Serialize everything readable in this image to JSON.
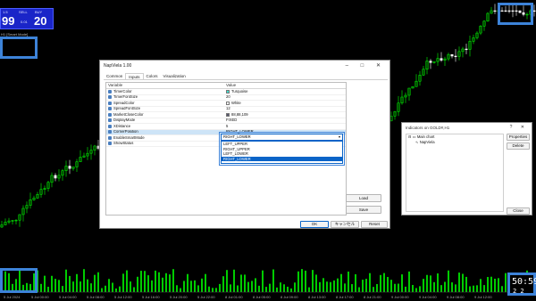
{
  "chart": {
    "symbol_bar": "GOLD#,H1: GOLD",
    "sub_label": "H1 [Smart Mode]",
    "bid_small": "1.5",
    "ask_small": "SELL",
    "buy_small": "BUY",
    "bid_big": "99",
    "ask_big": "20",
    "mid_label": "0.01",
    "spread_label": "2,670",
    "timer_main": "50:59",
    "timer_sub": "2 2",
    "x_labels": [
      "5 Jul 2024",
      "5 Jul 00:00",
      "5 Jul 04:00",
      "5 Jul 08:00",
      "5 Jul 12:00",
      "5 Jul 16:00",
      "5 Jul 20:00",
      "5 Jul 22:00",
      "8 Jul 01:00",
      "8 Jul 05:00",
      "8 Jul 09:00",
      "8 Jul 13:00",
      "8 Jul 17:00",
      "8 Jul 21:00",
      "9 Jul 00:00",
      "9 Jul 04:00",
      "9 Jul 08:00",
      "9 Jul 12:00"
    ]
  },
  "dialog": {
    "title": "NapViela 1.00",
    "window_buttons": "–  □  ✕",
    "tabs": [
      "Common",
      "Inputs",
      "Colors",
      "Visualization"
    ],
    "columns": {
      "variable": "Variable",
      "value": "Value"
    },
    "rows": [
      {
        "variable": "TimerColor",
        "value": "Turquoise",
        "swatch": "#40e0d0"
      },
      {
        "variable": "TimerFontSize",
        "value": "20"
      },
      {
        "variable": "SpreadColor",
        "value": "White",
        "swatch": "#ffffff"
      },
      {
        "variable": "SpreadFontSize",
        "value": "12"
      },
      {
        "variable": "MarketCloseColor",
        "value": "88,88,109",
        "swatch": "#58586d"
      },
      {
        "variable": "DisplayMode",
        "value": "FIXED"
      },
      {
        "variable": "XDistance",
        "value": "5"
      },
      {
        "variable": "CornerPosition",
        "value": "RIGHT_LOWER"
      },
      {
        "variable": "EnableSmartMode",
        "value": ""
      },
      {
        "variable": "ShowStatus",
        "value": ""
      }
    ],
    "dropdown": {
      "current": "RIGHT_LOWER",
      "options": [
        "LEFT_UPPER",
        "RIGHT_UPPER",
        "LEFT_LOWER",
        "RIGHT_LOWER"
      ],
      "selected_index": 3
    },
    "load_label": "Load",
    "save_label": "Save",
    "ok_label": "OK",
    "cancel_label": "キャンセル",
    "reset_label": "Reset"
  },
  "side_dialog": {
    "title": "Indicators on GOLD#,H1",
    "close_buttons": "?  ✕",
    "tree": {
      "root": "Main chart",
      "child": "NapViela"
    },
    "properties_label": "Properties",
    "delete_label": "Delete",
    "close_label": "Close"
  },
  "colors": {
    "bull": "#00ff00",
    "bear": "#ffffff",
    "volume": "#00cc00",
    "highlight": "#3d83d9",
    "dialog_accent": "#0a64c8"
  }
}
